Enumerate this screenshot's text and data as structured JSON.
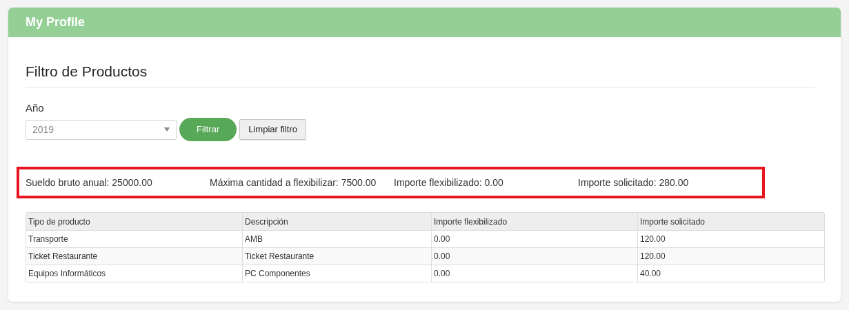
{
  "panel": {
    "title": "My Profile"
  },
  "section_title": "Filtro de Productos",
  "filter": {
    "label": "Año",
    "value": "2019",
    "buttons": [
      "Filtrar",
      "Limpiar filtro"
    ]
  },
  "summary": [
    "Sueldo bruto anual: 25000.00",
    "Máxima cantidad a flexibilizar: 7500.00",
    "Importe flexibilizado: 0.00",
    "Importe solicitado: 280.00"
  ],
  "table": {
    "columns": [
      "Tipo de producto",
      "Descripción",
      "Importe flexibilizado",
      "Importe solicitado"
    ],
    "rows": [
      [
        "Transporte",
        "AMB",
        "0.00",
        "120.00"
      ],
      [
        "Ticket Restaurante",
        "Ticket Restaurante",
        "0.00",
        "120.00"
      ],
      [
        "Equipos Informáticos",
        "PC Componentes",
        "0.00",
        "40.00"
      ]
    ]
  }
}
